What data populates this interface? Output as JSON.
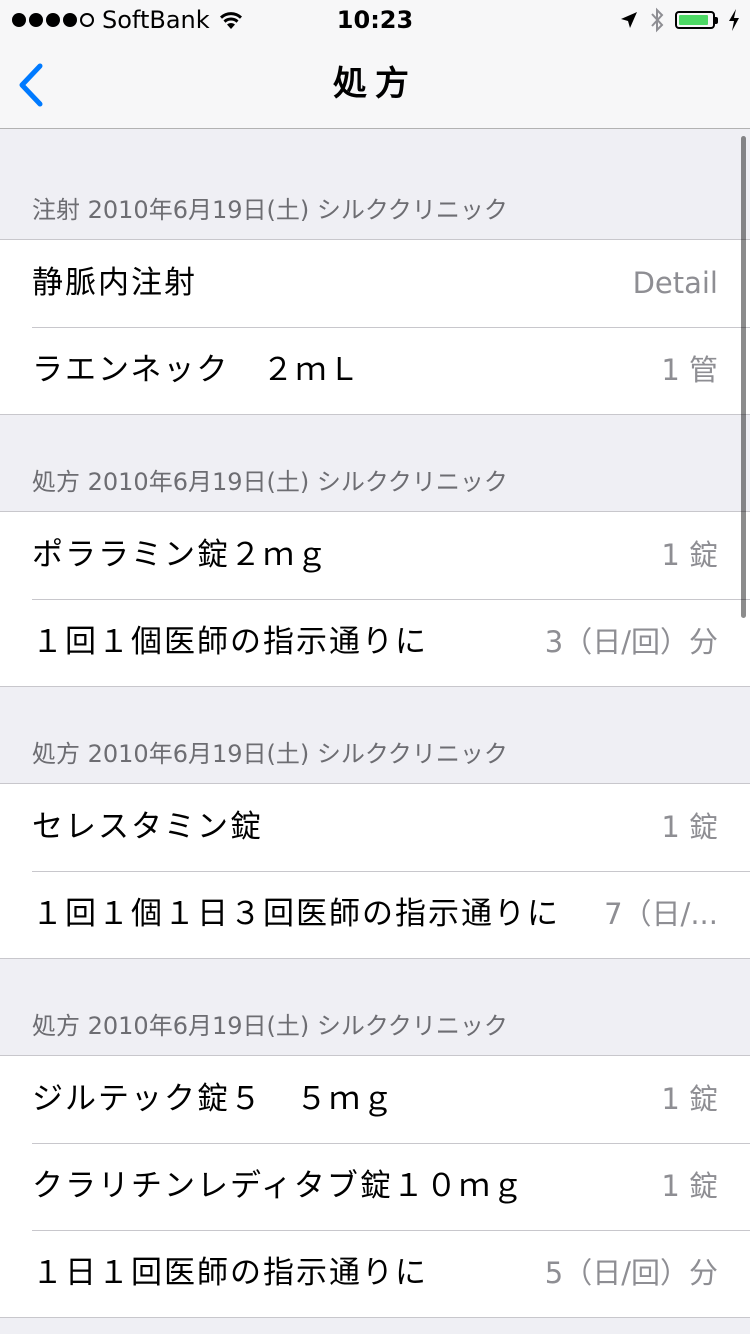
{
  "status_bar": {
    "carrier": "SoftBank",
    "time": "10:23",
    "battery_level": 0.9,
    "colors": {
      "battery": "#4cd964"
    }
  },
  "nav": {
    "title": "処方",
    "back_icon": "chevron-left-icon",
    "accent_color": "#007aff"
  },
  "sections": [
    {
      "header": "注射 2010年6月19日(土) シルククリニック",
      "rows": [
        {
          "label": "静脈内注射",
          "detail": "Detail"
        },
        {
          "label": "ラエンネック　２ｍＬ",
          "detail": "1 管"
        }
      ]
    },
    {
      "header": "処方 2010年6月19日(土) シルククリニック",
      "rows": [
        {
          "label": "ポララミン錠２ｍｇ",
          "detail": "1 錠"
        },
        {
          "label": "１回１個医師の指示通りに",
          "detail": "3（日/回）分"
        }
      ]
    },
    {
      "header": "処方 2010年6月19日(土) シルククリニック",
      "rows": [
        {
          "label": "セレスタミン錠",
          "detail": "1 錠"
        },
        {
          "label": "１回１個１日３回医師の指示通りに",
          "detail": "7（日/..."
        }
      ]
    },
    {
      "header": "処方 2010年6月19日(土) シルククリニック",
      "rows": [
        {
          "label": "ジルテック錠５　５ｍｇ",
          "detail": "1 錠"
        },
        {
          "label": "クラリチンレディタブ錠１０ｍｇ",
          "detail": "1 錠"
        },
        {
          "label": "１日１回医師の指示通りに",
          "detail": "5（日/回）分"
        }
      ]
    }
  ]
}
